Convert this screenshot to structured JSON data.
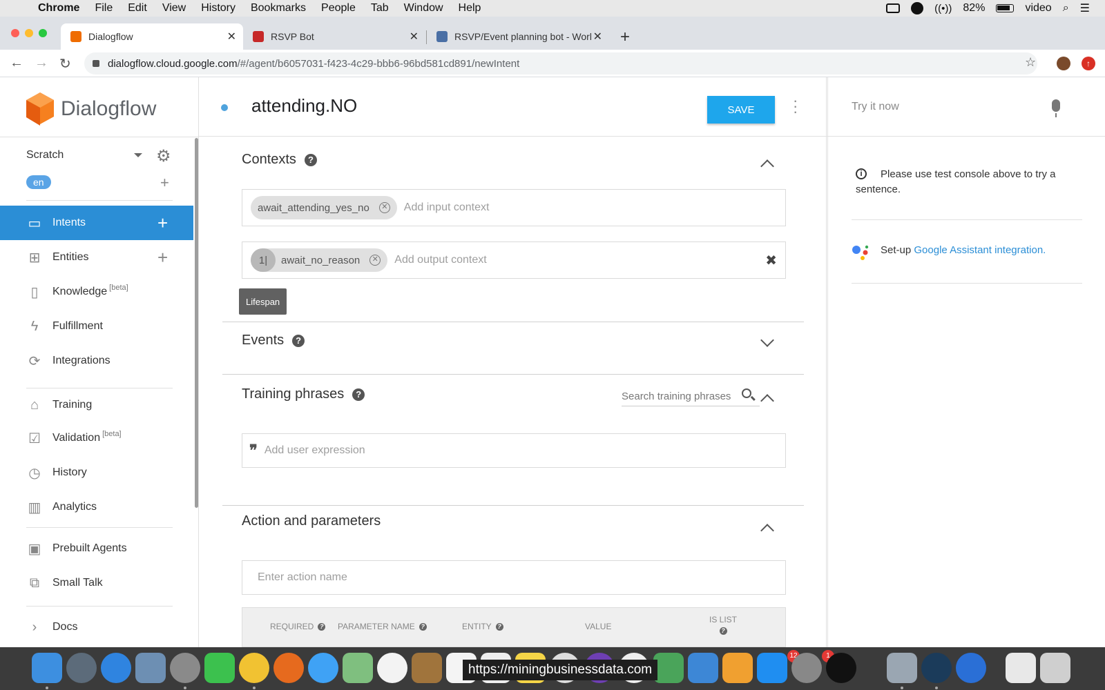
{
  "menubar": {
    "app": "Chrome",
    "items": [
      "File",
      "Edit",
      "View",
      "History",
      "Bookmarks",
      "People",
      "Tab",
      "Window",
      "Help"
    ],
    "battery": "82%",
    "user": "video"
  },
  "browser": {
    "tabs": [
      {
        "title": "Dialogflow",
        "favicon_color": "#ef6c00"
      },
      {
        "title": "RSVP Bot",
        "favicon_color": "#c62828"
      },
      {
        "title": "RSVP/Event planning bot - Work",
        "favicon_color": "#4a6fa5"
      }
    ],
    "url_host": "dialogflow.cloud.google.com",
    "url_path": "/#/agent/b6057031-f423-4c29-bbb6-96bd581cd891/newIntent"
  },
  "sidebar": {
    "logo_text": "Dialogflow",
    "agent_name": "Scratch",
    "language": "en",
    "items": [
      {
        "label": "Intents",
        "icon": "chat-icon"
      },
      {
        "label": "Entities",
        "icon": "hierarchy-icon"
      },
      {
        "label": "Knowledge",
        "beta": "[beta]",
        "icon": "book-icon"
      },
      {
        "label": "Fulfillment",
        "icon": "bolt-icon"
      },
      {
        "label": "Integrations",
        "icon": "sync-icon"
      },
      {
        "label": "Training",
        "icon": "graduation-cap-icon"
      },
      {
        "label": "Validation",
        "beta": "[beta]",
        "icon": "checkbox-icon"
      },
      {
        "label": "History",
        "icon": "clock-icon"
      },
      {
        "label": "Analytics",
        "icon": "bar-chart-icon"
      },
      {
        "label": "Prebuilt Agents",
        "icon": "agent-book-icon"
      },
      {
        "label": "Small Talk",
        "icon": "chat-bubbles-icon"
      },
      {
        "label": "Docs",
        "icon": "chevron-right-icon"
      }
    ]
  },
  "intent": {
    "name": "attending.NO",
    "save_label": "SAVE"
  },
  "contexts": {
    "title": "Contexts",
    "input_chip": "await_attending_yes_no",
    "input_placeholder": "Add input context",
    "output_lifespan": "1|",
    "output_chip": "await_no_reason",
    "output_placeholder": "Add output context",
    "tooltip": "Lifespan"
  },
  "events": {
    "title": "Events"
  },
  "training": {
    "title": "Training phrases",
    "search_placeholder": "Search training phrases",
    "expression_placeholder": "Add user expression"
  },
  "actions": {
    "title": "Action and parameters",
    "action_placeholder": "Enter action name",
    "columns": [
      "REQUIRED",
      "PARAMETER NAME",
      "ENTITY",
      "VALUE",
      "IS LIST"
    ]
  },
  "console": {
    "try_placeholder": "Try it now",
    "info": "Please use test console above to try a sentence.",
    "setup_prefix": "Set-up",
    "setup_link": "Google Assistant integration."
  },
  "dock": {
    "overlay_url": "https://miningbusinessdata.com",
    "badges": [
      "12",
      "1"
    ]
  }
}
